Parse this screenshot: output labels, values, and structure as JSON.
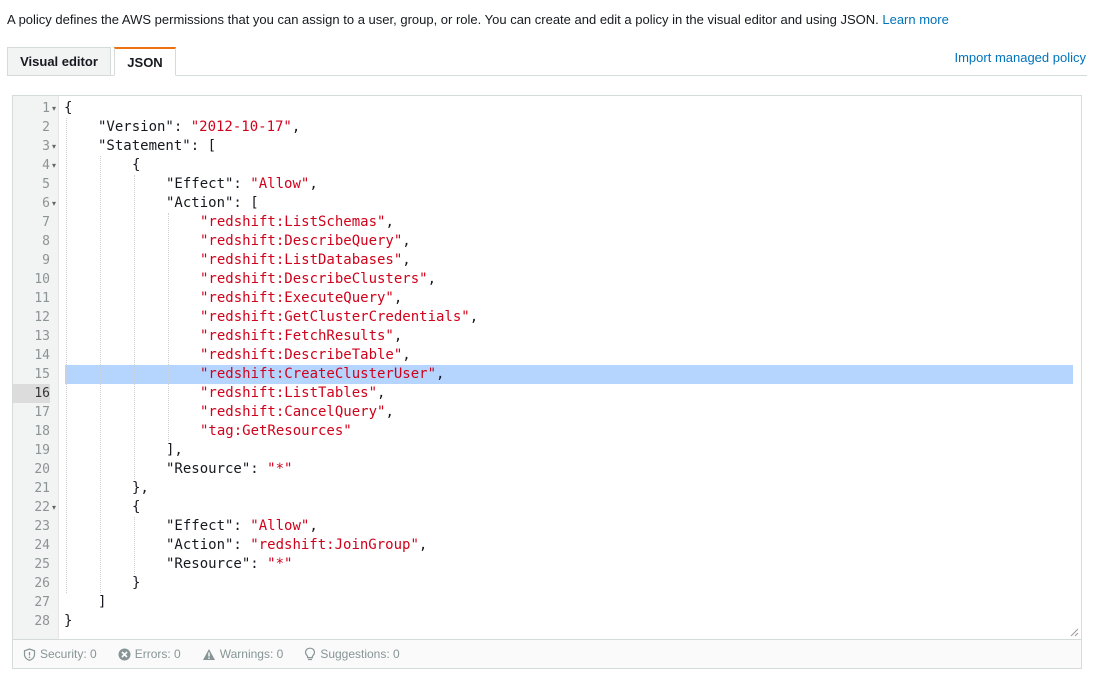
{
  "intro": {
    "text": "A policy defines the AWS permissions that you can assign to a user, group, or role. You can create and edit a policy in the visual editor and using JSON. ",
    "learn_more": "Learn more"
  },
  "tabs": [
    {
      "label": "Visual editor",
      "active": false
    },
    {
      "label": "JSON",
      "active": true
    }
  ],
  "import_link": "Import managed policy",
  "editor": {
    "highlighted_line": 15,
    "active_line": 16,
    "lines": [
      {
        "n": "1",
        "fold": true,
        "indent": 0,
        "tokens": [
          {
            "t": "{"
          }
        ]
      },
      {
        "n": "2",
        "fold": false,
        "indent": 1,
        "tokens": [
          {
            "t": "\"Version\": "
          },
          {
            "t": "\"2012-10-17\"",
            "s": true
          },
          {
            "t": ","
          }
        ]
      },
      {
        "n": "3",
        "fold": true,
        "indent": 1,
        "tokens": [
          {
            "t": "\"Statement\": ["
          }
        ]
      },
      {
        "n": "4",
        "fold": true,
        "indent": 2,
        "tokens": [
          {
            "t": "{"
          }
        ]
      },
      {
        "n": "5",
        "fold": false,
        "indent": 3,
        "tokens": [
          {
            "t": "\"Effect\": "
          },
          {
            "t": "\"Allow\"",
            "s": true
          },
          {
            "t": ","
          }
        ]
      },
      {
        "n": "6",
        "fold": true,
        "indent": 3,
        "tokens": [
          {
            "t": "\"Action\": ["
          }
        ]
      },
      {
        "n": "7",
        "fold": false,
        "indent": 4,
        "tokens": [
          {
            "t": "\"redshift:ListSchemas\"",
            "s": true
          },
          {
            "t": ","
          }
        ]
      },
      {
        "n": "8",
        "fold": false,
        "indent": 4,
        "tokens": [
          {
            "t": "\"redshift:DescribeQuery\"",
            "s": true
          },
          {
            "t": ","
          }
        ]
      },
      {
        "n": "9",
        "fold": false,
        "indent": 4,
        "tokens": [
          {
            "t": "\"redshift:ListDatabases\"",
            "s": true
          },
          {
            "t": ","
          }
        ]
      },
      {
        "n": "10",
        "fold": false,
        "indent": 4,
        "tokens": [
          {
            "t": "\"redshift:DescribeClusters\"",
            "s": true
          },
          {
            "t": ","
          }
        ]
      },
      {
        "n": "11",
        "fold": false,
        "indent": 4,
        "tokens": [
          {
            "t": "\"redshift:ExecuteQuery\"",
            "s": true
          },
          {
            "t": ","
          }
        ]
      },
      {
        "n": "12",
        "fold": false,
        "indent": 4,
        "tokens": [
          {
            "t": "\"redshift:GetClusterCredentials\"",
            "s": true
          },
          {
            "t": ","
          }
        ]
      },
      {
        "n": "13",
        "fold": false,
        "indent": 4,
        "tokens": [
          {
            "t": "\"redshift:FetchResults\"",
            "s": true
          },
          {
            "t": ","
          }
        ]
      },
      {
        "n": "14",
        "fold": false,
        "indent": 4,
        "tokens": [
          {
            "t": "\"redshift:DescribeTable\"",
            "s": true
          },
          {
            "t": ","
          }
        ]
      },
      {
        "n": "15",
        "fold": false,
        "indent": 4,
        "tokens": [
          {
            "t": "\"redshift:CreateClusterUser\"",
            "s": true
          },
          {
            "t": ","
          }
        ]
      },
      {
        "n": "16",
        "fold": false,
        "indent": 4,
        "tokens": [
          {
            "t": "\"redshift:ListTables\"",
            "s": true
          },
          {
            "t": ","
          }
        ]
      },
      {
        "n": "17",
        "fold": false,
        "indent": 4,
        "tokens": [
          {
            "t": "\"redshift:CancelQuery\"",
            "s": true
          },
          {
            "t": ","
          }
        ]
      },
      {
        "n": "18",
        "fold": false,
        "indent": 4,
        "tokens": [
          {
            "t": "\"tag:GetResources\"",
            "s": true
          }
        ]
      },
      {
        "n": "19",
        "fold": false,
        "indent": 3,
        "tokens": [
          {
            "t": "],"
          }
        ]
      },
      {
        "n": "20",
        "fold": false,
        "indent": 3,
        "tokens": [
          {
            "t": "\"Resource\": "
          },
          {
            "t": "\"*\"",
            "s": true
          }
        ]
      },
      {
        "n": "21",
        "fold": false,
        "indent": 2,
        "tokens": [
          {
            "t": "},"
          }
        ]
      },
      {
        "n": "22",
        "fold": true,
        "indent": 2,
        "tokens": [
          {
            "t": "{"
          }
        ]
      },
      {
        "n": "23",
        "fold": false,
        "indent": 3,
        "tokens": [
          {
            "t": "\"Effect\": "
          },
          {
            "t": "\"Allow\"",
            "s": true
          },
          {
            "t": ","
          }
        ]
      },
      {
        "n": "24",
        "fold": false,
        "indent": 3,
        "tokens": [
          {
            "t": "\"Action\": "
          },
          {
            "t": "\"redshift:JoinGroup\"",
            "s": true
          },
          {
            "t": ","
          }
        ]
      },
      {
        "n": "25",
        "fold": false,
        "indent": 3,
        "tokens": [
          {
            "t": "\"Resource\": "
          },
          {
            "t": "\"*\"",
            "s": true
          }
        ]
      },
      {
        "n": "26",
        "fold": false,
        "indent": 2,
        "tokens": [
          {
            "t": "}"
          }
        ]
      },
      {
        "n": "27",
        "fold": false,
        "indent": 1,
        "tokens": [
          {
            "t": "]"
          }
        ]
      },
      {
        "n": "28",
        "fold": false,
        "indent": 0,
        "tokens": [
          {
            "t": "}"
          }
        ]
      }
    ]
  },
  "status": {
    "security": "Security: 0",
    "errors": "Errors: 0",
    "warnings": "Warnings: 0",
    "suggestions": "Suggestions: 0"
  },
  "colors": {
    "link": "#0073bb",
    "tab_accent": "#ec7211",
    "string": "#d0021b",
    "selection": "#b5d5ff"
  }
}
